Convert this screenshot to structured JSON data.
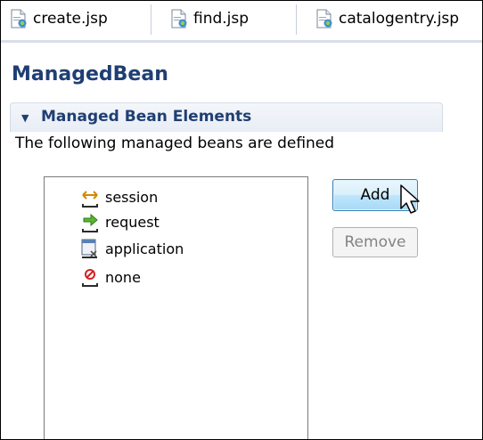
{
  "tabs": [
    {
      "label": "create.jsp"
    },
    {
      "label": "find.jsp"
    },
    {
      "label": "catalogentry.jsp"
    }
  ],
  "page_title": "ManagedBean",
  "section": {
    "title": "Managed Bean Elements",
    "description": "The following managed beans are defined"
  },
  "list": [
    {
      "label": "session",
      "icon": "session-scope-icon"
    },
    {
      "label": "request",
      "icon": "request-scope-icon"
    },
    {
      "label": "application",
      "icon": "application-scope-icon"
    },
    {
      "label": "none",
      "icon": "none-scope-icon"
    }
  ],
  "buttons": {
    "add": "Add",
    "remove": "Remove"
  },
  "colors": {
    "title": "#1f3f73",
    "button_hover": "#bee6fd"
  }
}
